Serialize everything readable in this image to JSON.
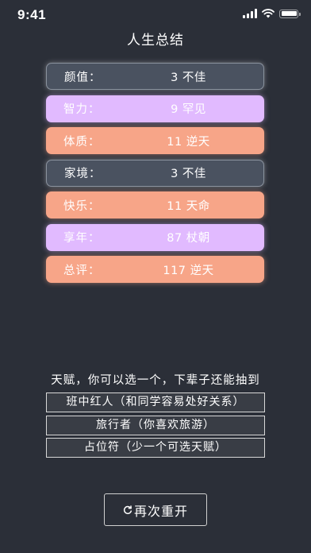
{
  "status_bar": {
    "time": "9:41",
    "icons": [
      "signal-icon",
      "wifi-icon",
      "battery-icon"
    ]
  },
  "title": "人生总结",
  "summary": [
    {
      "label": "颜值：",
      "value": "3 不佳",
      "grade": "dark"
    },
    {
      "label": "智力：",
      "value": "9 罕见",
      "grade": "purple"
    },
    {
      "label": "体质：",
      "value": "11 逆天",
      "grade": "orange"
    },
    {
      "label": "家境：",
      "value": "3 不佳",
      "grade": "dark"
    },
    {
      "label": "快乐：",
      "value": "11 天命",
      "grade": "orange"
    },
    {
      "label": "享年：",
      "value": "87 杖朝",
      "grade": "purple"
    },
    {
      "label": "总评：",
      "value": "117 逆天",
      "grade": "orange"
    }
  ],
  "colors": {
    "background": "#2b2f38",
    "grade_dark": "#4a5260",
    "grade_purple": "#e1baff",
    "grade_orange": "#f7a588"
  },
  "talent": {
    "prompt": "天赋，你可以选一个，下辈子还能抽到",
    "options": [
      "班中红人（和同学容易处好关系）",
      "旅行者（你喜欢旅游）",
      "占位符（少一个可选天赋）"
    ]
  },
  "restart": {
    "label": "再次重开",
    "icon": "refresh-icon"
  }
}
